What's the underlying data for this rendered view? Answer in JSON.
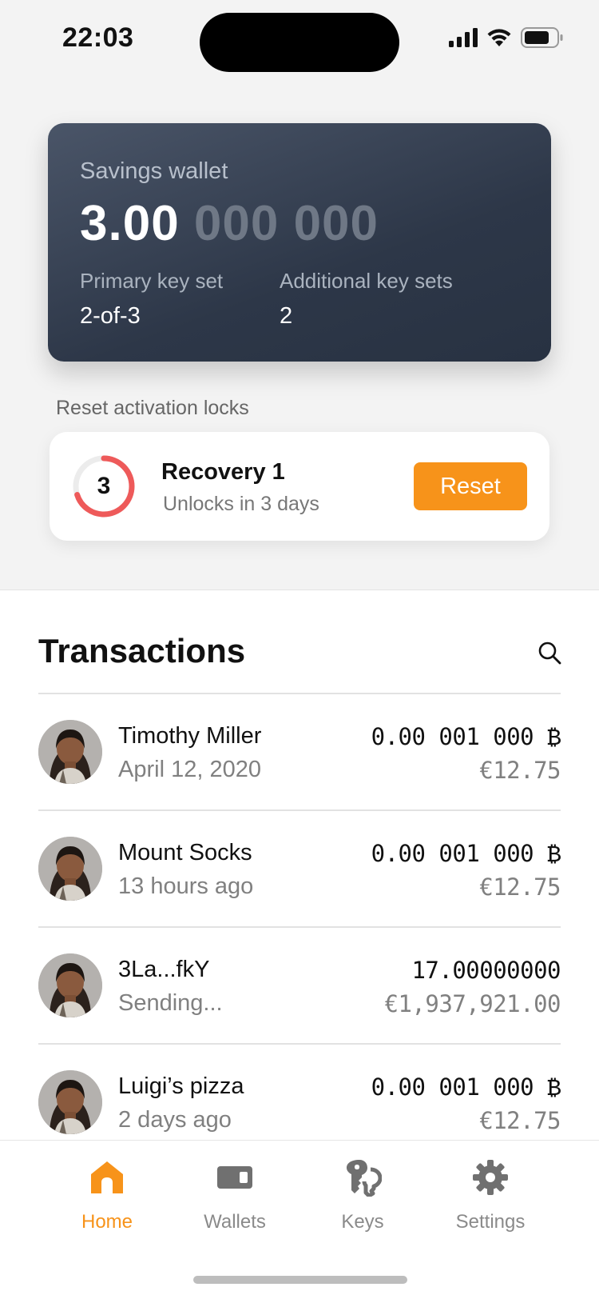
{
  "status_bar": {
    "time": "22:03"
  },
  "wallet": {
    "name": "Savings wallet",
    "balance_main": "3.00",
    "balance_dim": "000 000",
    "primary_label": "Primary key set",
    "primary_value": "2-of-3",
    "additional_label": "Additional key sets",
    "additional_value": "2"
  },
  "reset_section": {
    "title": "Reset activation locks",
    "countdown": "3",
    "countdown_fraction": 0.7,
    "recovery_title": "Recovery 1",
    "recovery_sub": "Unlocks in 3 days",
    "button": "Reset"
  },
  "transactions": {
    "heading": "Transactions",
    "items": [
      {
        "name": "Timothy Miller",
        "time": "April 12, 2020",
        "btc": "0.00 001 000 ₿",
        "eur": "€12.75"
      },
      {
        "name": "Mount Socks",
        "time": "13 hours ago",
        "btc": "0.00 001 000 ₿",
        "eur": "€12.75"
      },
      {
        "name": "3La...fkY",
        "time": "Sending...",
        "btc": "17.00000000",
        "eur": "€1,937,921.00"
      },
      {
        "name": "Luigi’s pizza",
        "time": "2 days ago",
        "btc": "0.00 001 000 ₿",
        "eur": "€12.75"
      }
    ]
  },
  "tabs": [
    {
      "label": "Home",
      "icon": "home-icon",
      "active": true
    },
    {
      "label": "Wallets",
      "icon": "wallet-icon",
      "active": false
    },
    {
      "label": "Keys",
      "icon": "keys-icon",
      "active": false
    },
    {
      "label": "Settings",
      "icon": "gear-icon",
      "active": false
    }
  ],
  "colors": {
    "accent": "#f7931a",
    "ring": "#ee5a5a",
    "card_dark": "#2d3748"
  }
}
